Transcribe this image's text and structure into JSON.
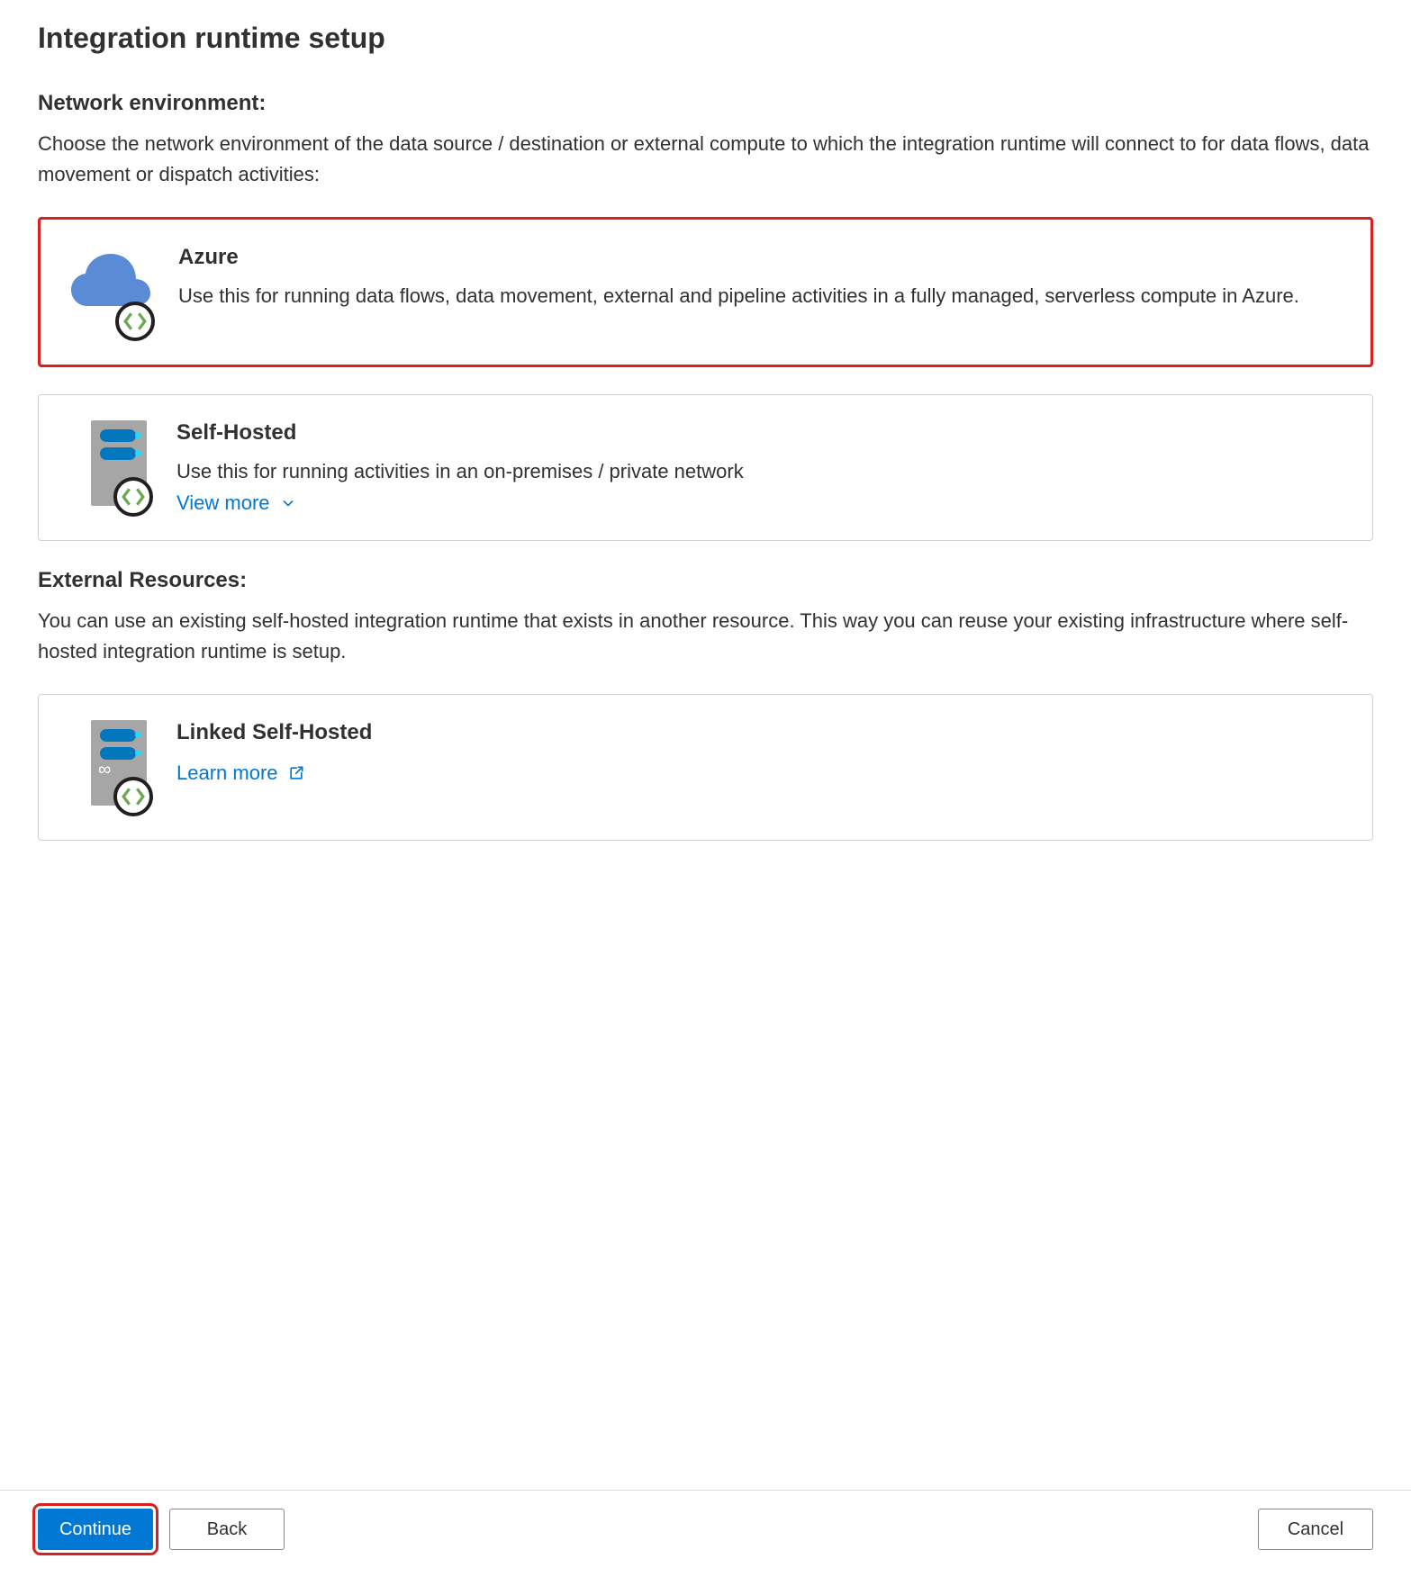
{
  "title": "Integration runtime setup",
  "network": {
    "label": "Network environment:",
    "description": "Choose the network environment of the data source / destination or external compute to which the integration runtime will connect to for data flows, data movement or dispatch activities:",
    "options": {
      "azure": {
        "title": "Azure",
        "description": "Use this for running data flows, data movement, external and pipeline activities in a fully managed, serverless compute in Azure."
      },
      "selfHosted": {
        "title": "Self-Hosted",
        "description": "Use this for running activities in an on-premises / private network",
        "link": "View more"
      }
    }
  },
  "external": {
    "label": "External Resources:",
    "description": "You can use an existing self-hosted integration runtime that exists in another resource. This way you can reuse your existing infrastructure where self-hosted integration runtime is setup.",
    "options": {
      "linkedSelfHosted": {
        "title": "Linked Self-Hosted",
        "link": "Learn more"
      }
    }
  },
  "buttons": {
    "continue": "Continue",
    "back": "Back",
    "cancel": "Cancel"
  }
}
